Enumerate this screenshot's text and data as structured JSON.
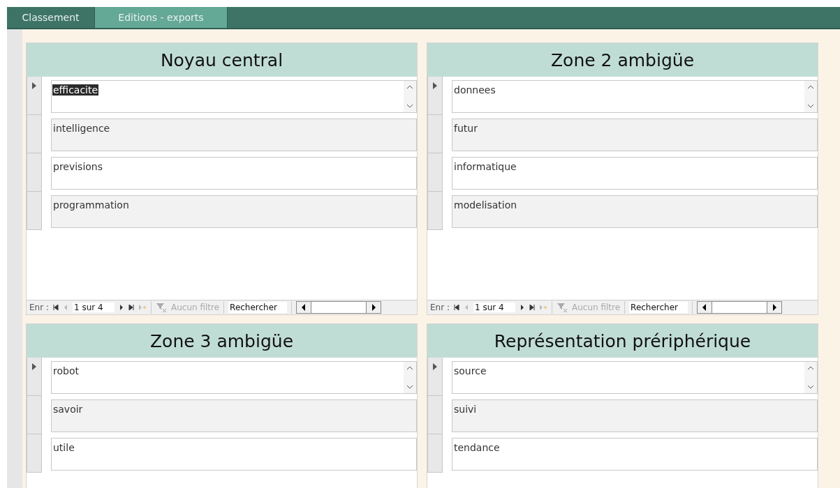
{
  "tabs": [
    {
      "label": "Classement",
      "selected": false
    },
    {
      "label": "Editions - exports",
      "selected": true
    }
  ],
  "panels": [
    {
      "title": "Noyau central",
      "rows": [
        {
          "value": "efficacite",
          "current": true,
          "highlighted": true
        },
        {
          "value": "intelligence",
          "current": false,
          "highlighted": false
        },
        {
          "value": "previsions",
          "current": false,
          "highlighted": false
        },
        {
          "value": "programmation",
          "current": false,
          "highlighted": false
        }
      ],
      "navigator": {
        "label": "Enr :",
        "position": "1 sur 4",
        "filter": "Aucun filtre",
        "search_placeholder": "Rechercher"
      }
    },
    {
      "title": "Zone 2 ambigüe",
      "rows": [
        {
          "value": "donnees",
          "current": true,
          "highlighted": false
        },
        {
          "value": "futur",
          "current": false,
          "highlighted": false
        },
        {
          "value": "informatique",
          "current": false,
          "highlighted": false
        },
        {
          "value": "modelisation",
          "current": false,
          "highlighted": false
        }
      ],
      "navigator": {
        "label": "Enr :",
        "position": "1 sur 4",
        "filter": "Aucun filtre",
        "search_placeholder": "Rechercher"
      }
    },
    {
      "title": "Zone 3 ambigüe",
      "rows": [
        {
          "value": "robot",
          "current": true,
          "highlighted": false
        },
        {
          "value": "savoir",
          "current": false,
          "highlighted": false
        },
        {
          "value": "utile",
          "current": false,
          "highlighted": false
        }
      ]
    },
    {
      "title": "Représentation prériphérique",
      "rows": [
        {
          "value": "source",
          "current": true,
          "highlighted": false
        },
        {
          "value": "suivi",
          "current": false,
          "highlighted": false
        },
        {
          "value": "tendance",
          "current": false,
          "highlighted": false
        }
      ]
    }
  ]
}
